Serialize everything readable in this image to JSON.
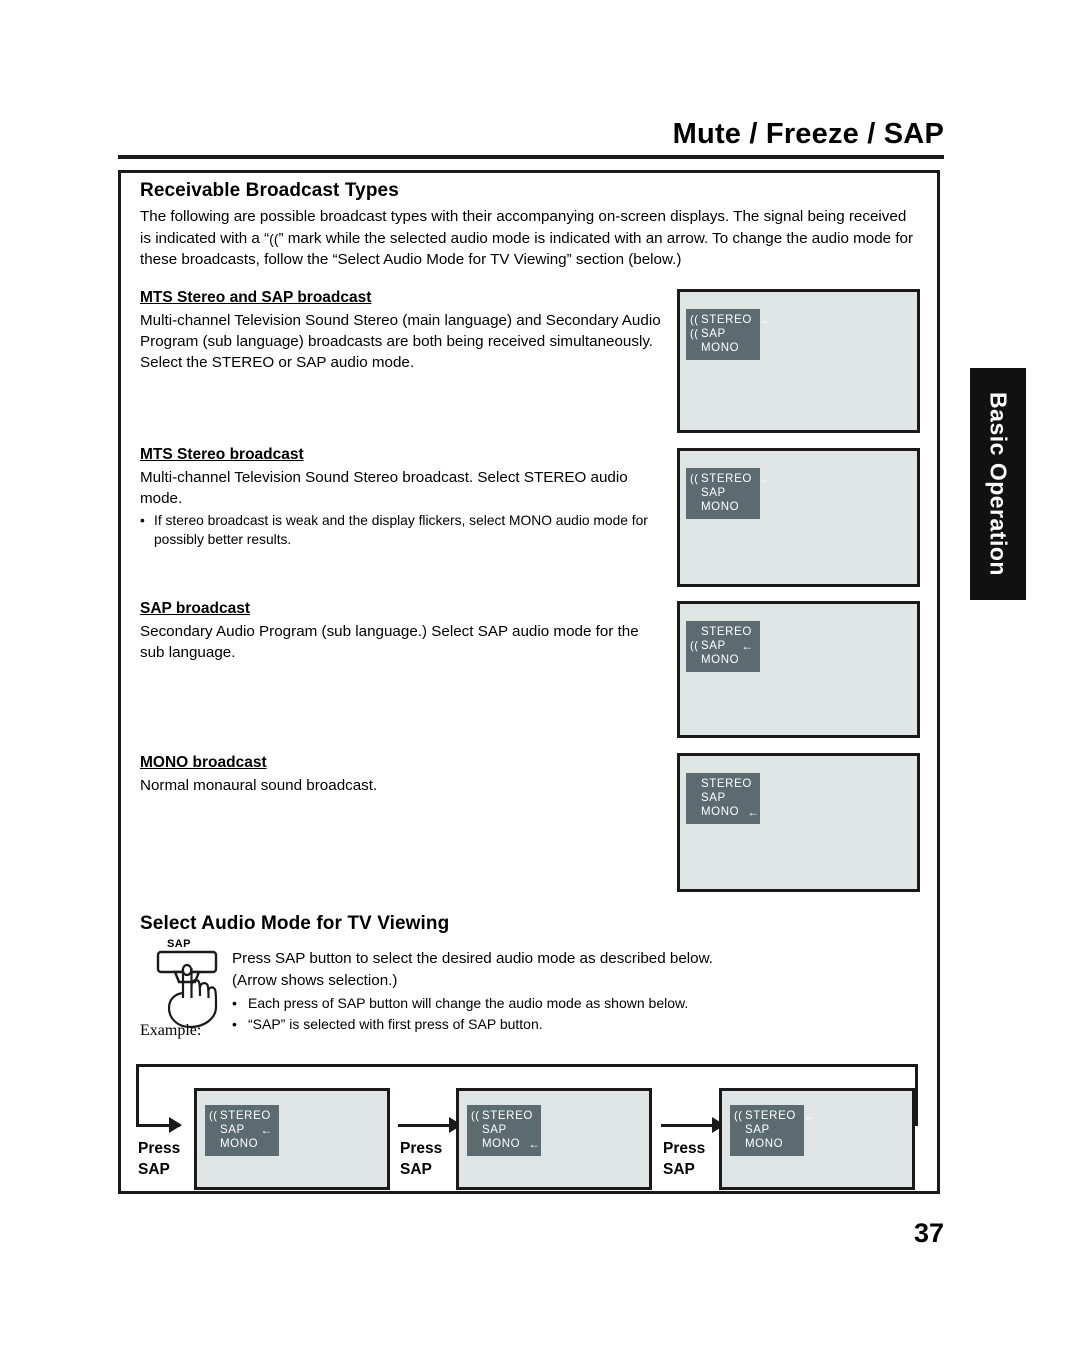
{
  "header": {
    "title": "Mute / Freeze / SAP"
  },
  "side_tab": {
    "label": "Basic Operation"
  },
  "footer": {
    "page_number": "37"
  },
  "section1": {
    "heading": "Receivable Broadcast Types",
    "intro_part1": "The following are possible broadcast types with their accompanying on-screen displays. The signal being received is indicated with a “",
    "intro_signal_mark": "((",
    "intro_part2": "” mark while the selected audio mode is indicated with an arrow. To change the audio mode for these broadcasts, follow the “Select Audio Mode for TV Viewing” section (below.)",
    "blocks": [
      {
        "title": "MTS Stereo and SAP broadcast",
        "body": "Multi-channel Television Sound Stereo (main language) and Secondary Audio Program (sub language) broadcasts are both being received simultaneously. Select the STEREO or SAP audio mode.",
        "bullet": ""
      },
      {
        "title": "MTS Stereo broadcast",
        "body": "Multi-channel Television Sound Stereo broadcast. Select STEREO audio mode.",
        "bullet": "If stereo broadcast is weak and the display flickers, select MONO audio mode for possibly better results."
      },
      {
        "title": "SAP broadcast",
        "body": "Secondary Audio Program (sub language.) Select SAP audio mode for the sub language.",
        "bullet": ""
      },
      {
        "title": "MONO broadcast",
        "body": "Normal monaural sound broadcast.",
        "bullet": ""
      }
    ],
    "osd_screens": [
      {
        "rows": [
          {
            "signal": "((",
            "label": "STEREO",
            "arrow": "←"
          },
          {
            "signal": "((",
            "label": "SAP",
            "arrow": ""
          },
          {
            "signal": "",
            "label": "MONO",
            "arrow": ""
          }
        ]
      },
      {
        "rows": [
          {
            "signal": "((",
            "label": "STEREO",
            "arrow": "←"
          },
          {
            "signal": "",
            "label": "SAP",
            "arrow": ""
          },
          {
            "signal": "",
            "label": "MONO",
            "arrow": ""
          }
        ]
      },
      {
        "rows": [
          {
            "signal": "",
            "label": "STEREO",
            "arrow": ""
          },
          {
            "signal": "((",
            "label": "SAP",
            "arrow": "←"
          },
          {
            "signal": "",
            "label": "MONO",
            "arrow": ""
          }
        ]
      },
      {
        "rows": [
          {
            "signal": "",
            "label": "STEREO",
            "arrow": ""
          },
          {
            "signal": "",
            "label": "SAP",
            "arrow": ""
          },
          {
            "signal": "",
            "label": "MONO",
            "arrow": "←"
          }
        ]
      }
    ]
  },
  "section2": {
    "heading": "Select Audio Mode for TV Viewing",
    "button_label": "SAP",
    "lead": "Press SAP button to select the desired audio mode as described below. (Arrow shows selection.)",
    "bullets": [
      "Each press of SAP button will change the audio mode as shown below.",
      "“SAP” is selected with first press of SAP button."
    ],
    "example_label": "Example:",
    "press_labels": [
      "Press SAP",
      "Press SAP",
      "Press SAP"
    ],
    "example_screens": [
      {
        "rows": [
          {
            "signal": "((",
            "label": "STEREO",
            "arrow": ""
          },
          {
            "signal": "",
            "label": "SAP",
            "arrow": "←"
          },
          {
            "signal": "",
            "label": "MONO",
            "arrow": ""
          }
        ]
      },
      {
        "rows": [
          {
            "signal": "((",
            "label": "STEREO",
            "arrow": ""
          },
          {
            "signal": "",
            "label": "SAP",
            "arrow": ""
          },
          {
            "signal": "",
            "label": "MONO",
            "arrow": "←"
          }
        ]
      },
      {
        "rows": [
          {
            "signal": "((",
            "label": "STEREO",
            "arrow": "←"
          },
          {
            "signal": "",
            "label": "SAP",
            "arrow": ""
          },
          {
            "signal": "",
            "label": "MONO",
            "arrow": ""
          }
        ]
      }
    ]
  },
  "colors": {
    "osd_panel": "#5c6b6f",
    "tv_screen": "#dfe4e5",
    "ink": "#1a1a1a",
    "tab_background": "#111111"
  }
}
